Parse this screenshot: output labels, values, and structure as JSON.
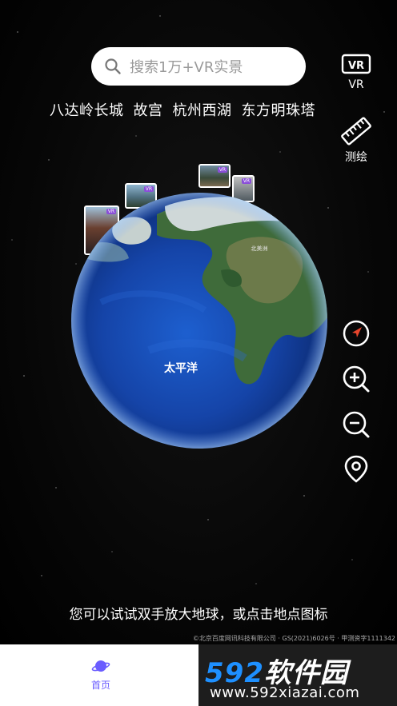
{
  "search": {
    "placeholder": "搜索1万+VR实景"
  },
  "side_actions": {
    "vr": {
      "label": "VR",
      "icon": "vr-headset-icon"
    },
    "measure": {
      "label": "测绘",
      "icon": "ruler-icon"
    }
  },
  "hot_places": [
    "八达岭长城",
    "故宫",
    "杭州西湖",
    "东方明珠塔"
  ],
  "globe": {
    "ocean_label": "太平洋",
    "small_label": "北美洲"
  },
  "thumbnails": [
    {
      "badge": "VR"
    },
    {
      "badge": "VR"
    },
    {
      "badge": "VR"
    },
    {
      "badge": "VR"
    }
  ],
  "map_controls": [
    {
      "name": "locate",
      "icon": "navigation-arrow-icon"
    },
    {
      "name": "zoom_in",
      "icon": "zoom-in-icon"
    },
    {
      "name": "zoom_out",
      "icon": "zoom-out-icon"
    },
    {
      "name": "place",
      "icon": "location-pin-icon"
    }
  ],
  "hint": "您可以试试双手放大地球，或点击地点图标",
  "copyright": "©北京百度网讯科技有限公司 · GS(2021)6026号 · 甲测资字1111342",
  "bottom_nav": {
    "home_label": "首页",
    "home_icon": "planet-icon",
    "accent": "#6a5cff"
  },
  "watermark": {
    "brand_number": "592",
    "brand_text": "软件园",
    "url": "www.592xiazai.com"
  }
}
